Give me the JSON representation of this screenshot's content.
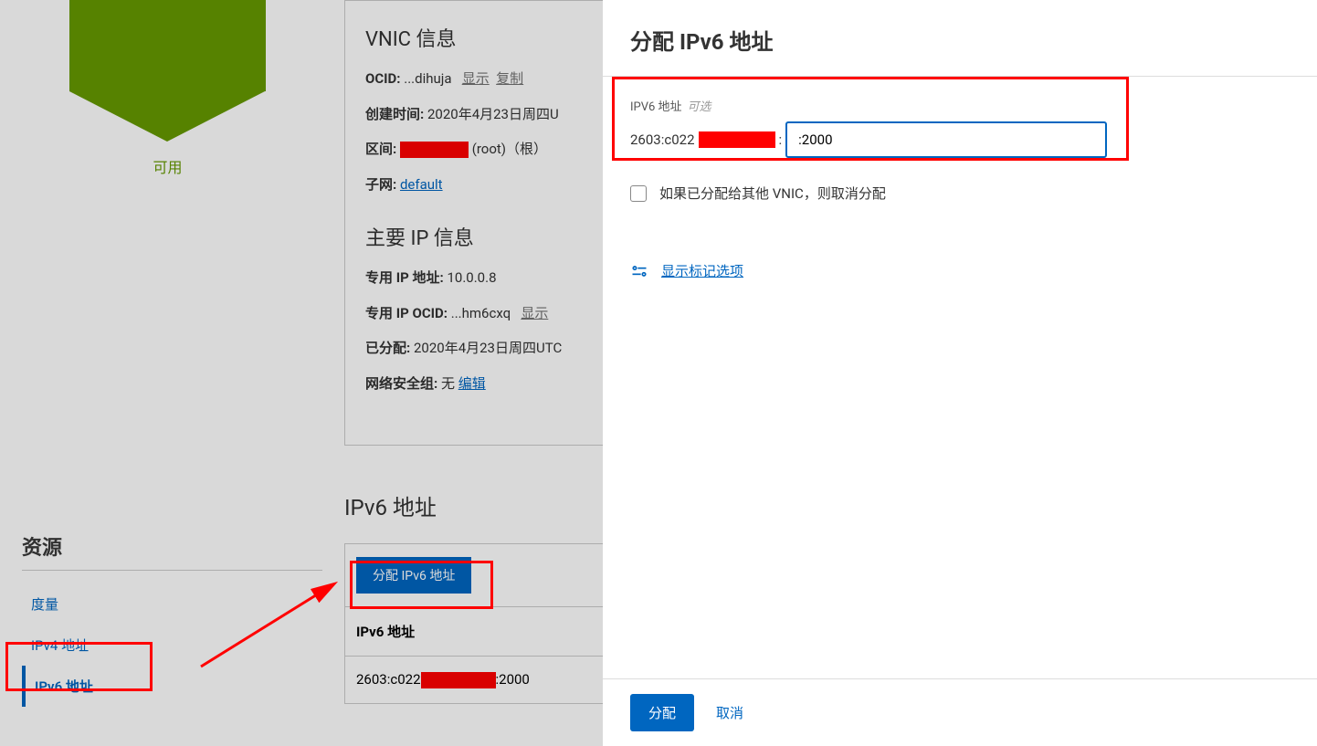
{
  "sidebar": {
    "status_badge": "可用",
    "resources_title": "资源",
    "nav": [
      {
        "label": "度量",
        "active": false
      },
      {
        "label": "IPv4 地址",
        "active": false
      },
      {
        "label": "IPv6 地址",
        "active": true
      }
    ]
  },
  "vnic": {
    "title": "VNIC 信息",
    "ocid_label": "OCID:",
    "ocid_value": "...dihuja",
    "ocid_show": "显示",
    "ocid_copy": "复制",
    "created_label": "创建时间:",
    "created_value": "2020年4月23日周四U",
    "compartment_label": "区间:",
    "compartment_suffix": "(root)（根）",
    "subnet_label": "子网:",
    "subnet_value": "default"
  },
  "primary_ip": {
    "title": "主要 IP 信息",
    "private_ip_label": "专用 IP 地址:",
    "private_ip_value": "10.0.0.8",
    "private_ip_ocid_label": "专用 IP OCID:",
    "private_ip_ocid_value": "...hm6cxq",
    "private_ip_ocid_show": "显示",
    "assigned_label": "已分配:",
    "assigned_value": "2020年4月23日周四UTC",
    "nsg_label": "网络安全组:",
    "nsg_value": "无",
    "nsg_edit": "编辑"
  },
  "ipv6_section": {
    "title": "IPv6 地址",
    "alloc_button": "分配 IPv6 地址",
    "col_header": "IPv6 地址",
    "row_prefix": "2603:c022",
    "row_suffix": ":2000"
  },
  "drawer": {
    "title": "分配 IPv6 地址",
    "input_label": "IPV6 地址",
    "input_optional": "可选",
    "prefix": "2603:c022",
    "prefix_colon": ":",
    "input_value": ":2000",
    "checkbox_label": "如果已分配给其他 VNIC，则取消分配",
    "show_tags": "显示标记选项",
    "submit": "分配",
    "cancel": "取消"
  }
}
